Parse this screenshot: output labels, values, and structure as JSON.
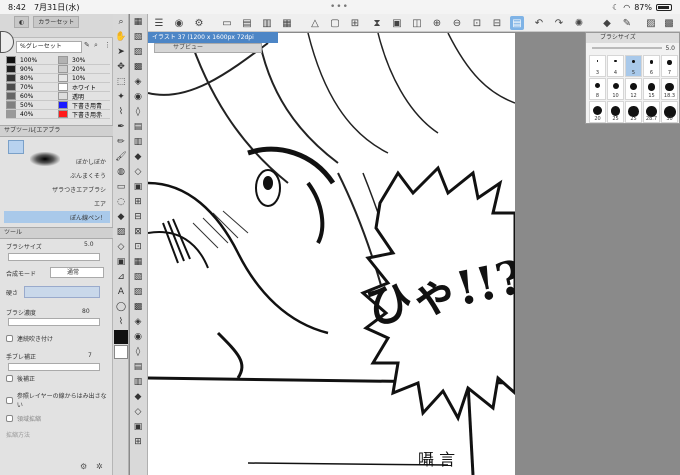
{
  "status": {
    "time": "8:42",
    "date": "7月31日(水)",
    "battery": "87%"
  },
  "color_panel": {
    "tab_color_set": "カラーセット",
    "preset": "%グレーセット",
    "swatches": [
      {
        "label": "100%",
        "color": "#111111"
      },
      {
        "label": "30%",
        "color": "#b2b2b2"
      },
      {
        "label": "90%",
        "color": "#1e1e1e"
      },
      {
        "label": "20%",
        "color": "#cccccc"
      },
      {
        "label": "80%",
        "color": "#333333"
      },
      {
        "label": "10%",
        "color": "#e6e6e6"
      },
      {
        "label": "70%",
        "color": "#4c4c4c"
      },
      {
        "label": "ホワイト",
        "color": "#ffffff"
      },
      {
        "label": "60%",
        "color": "#666666"
      },
      {
        "label": "透明",
        "color": "#dddddd"
      },
      {
        "label": "50%",
        "color": "#808080"
      },
      {
        "label": "下書き用青",
        "color": "#1a1aff"
      },
      {
        "label": "40%",
        "color": "#999999"
      },
      {
        "label": "下書き用赤",
        "color": "#ff1a1a"
      }
    ]
  },
  "subtool": {
    "header": "サブツール[エアブラ",
    "brushes": [
      "ぼかしぼか",
      "ぶんまくそう",
      "ザラつきエアブラシ",
      "エア",
      "ぽん線ペン！"
    ]
  },
  "tool_property": {
    "header": "ツール",
    "brush_size_label": "ブラシサイズ",
    "brush_size_value": "5.0",
    "blend_label": "合成モード",
    "blend_value": "通常",
    "hardness_label": "硬さ",
    "density_label": "ブラシ濃度",
    "density_value": "80",
    "continuous_label": "連続吹き付け",
    "stabilize_label": "手ブレ補正",
    "stabilize_value": "7",
    "post_correction_label": "後補正",
    "ref_layer_label": "参照レイヤーの線からはみ出さない",
    "expand_label": "領域拡縮",
    "expand_method_label": "拡縮方法"
  },
  "document": {
    "tab_title": "イラスト 37 (1200 x 1600px 72dpi 297.4%)",
    "subview_title": "サブビュー"
  },
  "brush_size_popup": {
    "title": "ブラシサイズ",
    "value": "5.0",
    "sizes": [
      "3",
      "4",
      "5",
      "6",
      "7",
      "8",
      "10",
      "12",
      "15",
      "18.3",
      "20",
      "25",
      "25",
      "28.7",
      "30"
    ],
    "selected_index": 2
  },
  "manga": {
    "bubble_text": "ひゃ!!?",
    "caption": "囁 言"
  }
}
